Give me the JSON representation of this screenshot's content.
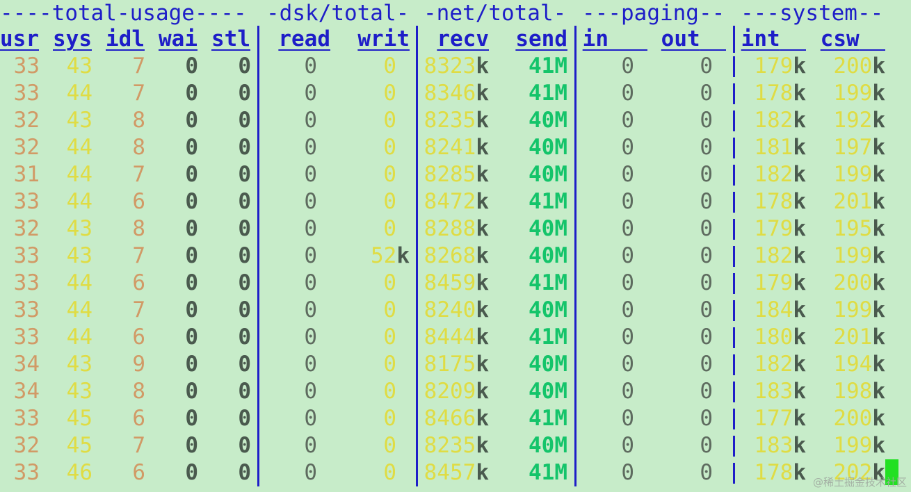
{
  "groups": {
    "total_usage": "----total-usage----",
    "dsk_total": "-dsk/total-",
    "net_total": "-net/total-",
    "paging": "---paging--",
    "system": "---system--"
  },
  "headers": {
    "usr": "usr",
    "sys": "sys",
    "idl": "idl",
    "wai": "wai",
    "stl": "stl",
    "read": "read",
    "writ": "writ",
    "recv": "recv",
    "send": "send",
    "in": "in",
    "out": "out",
    "int": "int",
    "csw": "csw"
  },
  "rows": [
    {
      "usr": "33",
      "sys": "43",
      "idl": "7",
      "wai": "0",
      "stl": "0",
      "read": "0",
      "writ": "0",
      "writ_unit": "",
      "recv": "8323",
      "recv_unit": "k",
      "send": "41",
      "send_unit": "M",
      "in": "0",
      "out": "0",
      "int": "179",
      "int_unit": "k",
      "csw": "200",
      "csw_unit": "k"
    },
    {
      "usr": "33",
      "sys": "44",
      "idl": "7",
      "wai": "0",
      "stl": "0",
      "read": "0",
      "writ": "0",
      "writ_unit": "",
      "recv": "8346",
      "recv_unit": "k",
      "send": "41",
      "send_unit": "M",
      "in": "0",
      "out": "0",
      "int": "178",
      "int_unit": "k",
      "csw": "199",
      "csw_unit": "k"
    },
    {
      "usr": "32",
      "sys": "43",
      "idl": "8",
      "wai": "0",
      "stl": "0",
      "read": "0",
      "writ": "0",
      "writ_unit": "",
      "recv": "8235",
      "recv_unit": "k",
      "send": "40",
      "send_unit": "M",
      "in": "0",
      "out": "0",
      "int": "182",
      "int_unit": "k",
      "csw": "192",
      "csw_unit": "k"
    },
    {
      "usr": "32",
      "sys": "44",
      "idl": "8",
      "wai": "0",
      "stl": "0",
      "read": "0",
      "writ": "0",
      "writ_unit": "",
      "recv": "8241",
      "recv_unit": "k",
      "send": "40",
      "send_unit": "M",
      "in": "0",
      "out": "0",
      "int": "181",
      "int_unit": "k",
      "csw": "197",
      "csw_unit": "k"
    },
    {
      "usr": "31",
      "sys": "44",
      "idl": "7",
      "wai": "0",
      "stl": "0",
      "read": "0",
      "writ": "0",
      "writ_unit": "",
      "recv": "8285",
      "recv_unit": "k",
      "send": "40",
      "send_unit": "M",
      "in": "0",
      "out": "0",
      "int": "182",
      "int_unit": "k",
      "csw": "199",
      "csw_unit": "k"
    },
    {
      "usr": "33",
      "sys": "44",
      "idl": "6",
      "wai": "0",
      "stl": "0",
      "read": "0",
      "writ": "0",
      "writ_unit": "",
      "recv": "8472",
      "recv_unit": "k",
      "send": "41",
      "send_unit": "M",
      "in": "0",
      "out": "0",
      "int": "178",
      "int_unit": "k",
      "csw": "201",
      "csw_unit": "k"
    },
    {
      "usr": "32",
      "sys": "43",
      "idl": "8",
      "wai": "0",
      "stl": "0",
      "read": "0",
      "writ": "0",
      "writ_unit": "",
      "recv": "8288",
      "recv_unit": "k",
      "send": "40",
      "send_unit": "M",
      "in": "0",
      "out": "0",
      "int": "179",
      "int_unit": "k",
      "csw": "195",
      "csw_unit": "k"
    },
    {
      "usr": "33",
      "sys": "43",
      "idl": "7",
      "wai": "0",
      "stl": "0",
      "read": "0",
      "writ": "52",
      "writ_unit": "k",
      "recv": "8268",
      "recv_unit": "k",
      "send": "40",
      "send_unit": "M",
      "in": "0",
      "out": "0",
      "int": "182",
      "int_unit": "k",
      "csw": "199",
      "csw_unit": "k"
    },
    {
      "usr": "33",
      "sys": "44",
      "idl": "6",
      "wai": "0",
      "stl": "0",
      "read": "0",
      "writ": "0",
      "writ_unit": "",
      "recv": "8459",
      "recv_unit": "k",
      "send": "41",
      "send_unit": "M",
      "in": "0",
      "out": "0",
      "int": "179",
      "int_unit": "k",
      "csw": "200",
      "csw_unit": "k"
    },
    {
      "usr": "33",
      "sys": "44",
      "idl": "7",
      "wai": "0",
      "stl": "0",
      "read": "0",
      "writ": "0",
      "writ_unit": "",
      "recv": "8240",
      "recv_unit": "k",
      "send": "40",
      "send_unit": "M",
      "in": "0",
      "out": "0",
      "int": "184",
      "int_unit": "k",
      "csw": "199",
      "csw_unit": "k"
    },
    {
      "usr": "33",
      "sys": "44",
      "idl": "6",
      "wai": "0",
      "stl": "0",
      "read": "0",
      "writ": "0",
      "writ_unit": "",
      "recv": "8444",
      "recv_unit": "k",
      "send": "41",
      "send_unit": "M",
      "in": "0",
      "out": "0",
      "int": "180",
      "int_unit": "k",
      "csw": "201",
      "csw_unit": "k"
    },
    {
      "usr": "34",
      "sys": "43",
      "idl": "9",
      "wai": "0",
      "stl": "0",
      "read": "0",
      "writ": "0",
      "writ_unit": "",
      "recv": "8175",
      "recv_unit": "k",
      "send": "40",
      "send_unit": "M",
      "in": "0",
      "out": "0",
      "int": "182",
      "int_unit": "k",
      "csw": "194",
      "csw_unit": "k"
    },
    {
      "usr": "34",
      "sys": "43",
      "idl": "8",
      "wai": "0",
      "stl": "0",
      "read": "0",
      "writ": "0",
      "writ_unit": "",
      "recv": "8209",
      "recv_unit": "k",
      "send": "40",
      "send_unit": "M",
      "in": "0",
      "out": "0",
      "int": "183",
      "int_unit": "k",
      "csw": "198",
      "csw_unit": "k"
    },
    {
      "usr": "33",
      "sys": "45",
      "idl": "6",
      "wai": "0",
      "stl": "0",
      "read": "0",
      "writ": "0",
      "writ_unit": "",
      "recv": "8466",
      "recv_unit": "k",
      "send": "41",
      "send_unit": "M",
      "in": "0",
      "out": "0",
      "int": "177",
      "int_unit": "k",
      "csw": "200",
      "csw_unit": "k"
    },
    {
      "usr": "32",
      "sys": "45",
      "idl": "7",
      "wai": "0",
      "stl": "0",
      "read": "0",
      "writ": "0",
      "writ_unit": "",
      "recv": "8235",
      "recv_unit": "k",
      "send": "40",
      "send_unit": "M",
      "in": "0",
      "out": "0",
      "int": "183",
      "int_unit": "k",
      "csw": "199",
      "csw_unit": "k"
    },
    {
      "usr": "33",
      "sys": "46",
      "idl": "6",
      "wai": "0",
      "stl": "0",
      "read": "0",
      "writ": "0",
      "writ_unit": "",
      "recv": "8457",
      "recv_unit": "k",
      "send": "41",
      "send_unit": "M",
      "in": "0",
      "out": "0",
      "int": "178",
      "int_unit": "k",
      "csw": "202",
      "csw_unit": "k"
    }
  ],
  "watermark": "@稀土掘金技术社区",
  "colors": {
    "background": "#c7ecc9",
    "header_blue": "#1e1ec8",
    "usr_orange": "#d19a66",
    "sys_yellow": "#dfdc44",
    "send_green": "#14c46a",
    "cursor_green": "#22e022"
  }
}
